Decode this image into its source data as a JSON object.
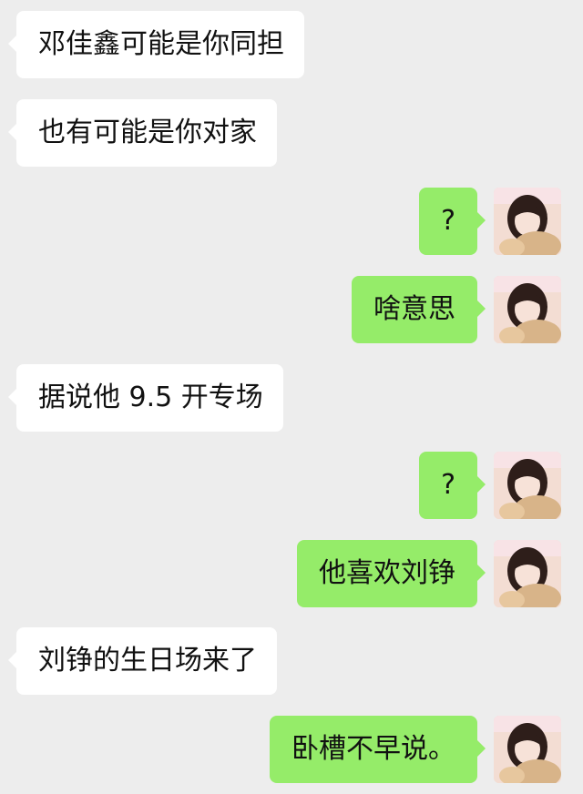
{
  "messages": [
    {
      "side": "left",
      "text": "邓佳鑫可能是你同担"
    },
    {
      "side": "left",
      "text": "也有可能是你对家"
    },
    {
      "side": "right",
      "text": "?"
    },
    {
      "side": "right",
      "text": "啥意思"
    },
    {
      "side": "left",
      "text": "据说他 9.5 开专场"
    },
    {
      "side": "right",
      "text": "?"
    },
    {
      "side": "right",
      "text": "他喜欢刘铮"
    },
    {
      "side": "left",
      "text": "刘铮的生日场来了"
    },
    {
      "side": "right",
      "text": "卧槽不早说。"
    }
  ],
  "colors": {
    "background": "#ededed",
    "incoming_bubble": "#ffffff",
    "outgoing_bubble": "#95ec69",
    "text": "#111111"
  },
  "icons": {
    "avatar": "user-avatar-photo"
  }
}
